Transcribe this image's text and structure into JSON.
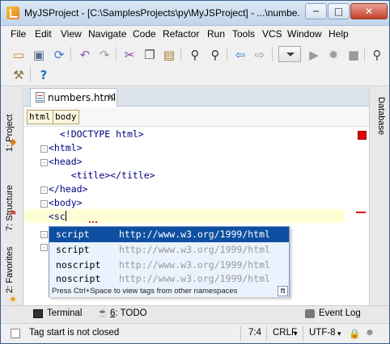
{
  "window": {
    "title": "MyJSProject - [C:\\SamplesProjects\\py\\MyJSProject] - ...\\numbe...",
    "minimize_glyph": "─",
    "maximize_glyph": "□",
    "close_glyph": "✕"
  },
  "menu": [
    "File",
    "Edit",
    "View",
    "Navigate",
    "Code",
    "Refactor",
    "Run",
    "Tools",
    "VCS",
    "Window",
    "Help"
  ],
  "toolbar": {
    "icons": [
      "open-folder-icon",
      "save-icon",
      "sync-icon",
      "undo-icon",
      "redo-icon",
      "cut-icon",
      "copy-icon",
      "paste-icon",
      "find-icon",
      "replace-icon",
      "back-icon",
      "forward-icon",
      "run-config-dropdown",
      "run-icon",
      "debug-icon",
      "stop-icon",
      "search-everywhere-icon",
      "settings-icon",
      "help-icon"
    ],
    "help_glyph": "?"
  },
  "left_tabs": [
    "1: Project",
    "7: Structure",
    "2: Favorites"
  ],
  "right_tabs": [
    "Database"
  ],
  "editor": {
    "tab_label": "numbers.html",
    "tab_close": "×",
    "breadcrumbs": [
      "html",
      "body"
    ],
    "lines": [
      {
        "indent": "  ",
        "text": "<!DOCTYPE html>"
      },
      {
        "indent": "",
        "text": "<html>"
      },
      {
        "indent": "",
        "text": "<head>"
      },
      {
        "indent": "    ",
        "text": "<title></title>"
      },
      {
        "indent": "",
        "text": "</head>"
      },
      {
        "indent": "",
        "text": "<body>"
      },
      {
        "indent": "",
        "text": "<sc"
      }
    ]
  },
  "completion": {
    "items": [
      {
        "name": "script",
        "ns": "http://www.w3.org/1999/html",
        "selected": true
      },
      {
        "name": "script",
        "ns": "http://www.w3.org/1999/html",
        "selected": false
      },
      {
        "name": "noscript",
        "ns": "http://www.w3.org/1999/html",
        "selected": false
      },
      {
        "name": "noscript",
        "ns": "http://www.w3.org/1999/html",
        "selected": false
      }
    ],
    "footer": "Press Ctrl+Space to view tags from other namespaces",
    "pi": "π"
  },
  "bottom_tools": {
    "terminal": "Terminal",
    "todo_num": "6",
    "todo_label": ": TODO",
    "event_log": "Event Log"
  },
  "status": {
    "message": "Tag start is not closed",
    "position": "7:4",
    "line_sep": "CRLF",
    "encoding": "UTF-8"
  },
  "colors": {
    "accent": "#0e4fa1",
    "error": "#e00000",
    "caret_line": "#ffffd7"
  }
}
